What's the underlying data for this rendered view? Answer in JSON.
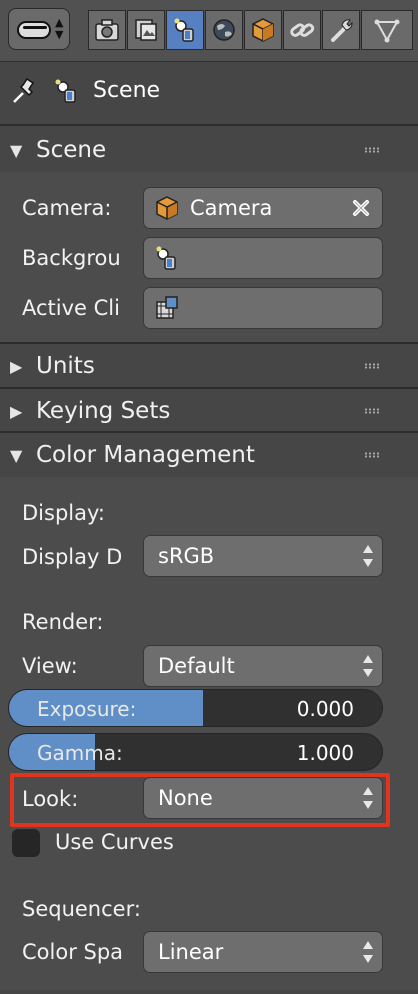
{
  "toolbar": {
    "tabs": [
      {
        "icon": "render-icon",
        "active": false
      },
      {
        "icon": "render-layers-icon",
        "active": false
      },
      {
        "icon": "scene-icon",
        "active": true
      },
      {
        "icon": "world-icon",
        "active": false
      },
      {
        "icon": "object-icon",
        "active": false
      },
      {
        "icon": "constraints-icon",
        "active": false
      },
      {
        "icon": "modifiers-icon",
        "active": false
      },
      {
        "icon": "object-data-icon",
        "active": false
      }
    ]
  },
  "context": {
    "title": "Scene"
  },
  "panels": {
    "scene": {
      "title": "Scene",
      "camera_label": "Camera:",
      "camera_value": "Camera",
      "background_label": "Backgrou",
      "active_clip_label": "Active Cli"
    },
    "units": {
      "title": "Units"
    },
    "keying_sets": {
      "title": "Keying Sets"
    },
    "color_management": {
      "title": "Color Management",
      "display_heading": "Display:",
      "display_device_label": "Display D",
      "display_device_value": "sRGB",
      "render_heading": "Render:",
      "view_label": "View:",
      "view_value": "Default",
      "exposure_label": "Exposure:",
      "exposure_value": "0.000",
      "exposure_fill": 0.52,
      "gamma_label": "Gamma:",
      "gamma_value": "1.000",
      "gamma_fill": 0.23,
      "look_label": "Look:",
      "look_value": "None",
      "use_curves_label": "Use Curves",
      "use_curves_checked": false,
      "sequencer_heading": "Sequencer:",
      "color_space_label": "Color Spa",
      "color_space_value": "Linear"
    }
  },
  "colors": {
    "accent": "#5680c2",
    "slider_fill": "#5f8fc6",
    "highlight": "#e0341f",
    "background": "#464646"
  }
}
